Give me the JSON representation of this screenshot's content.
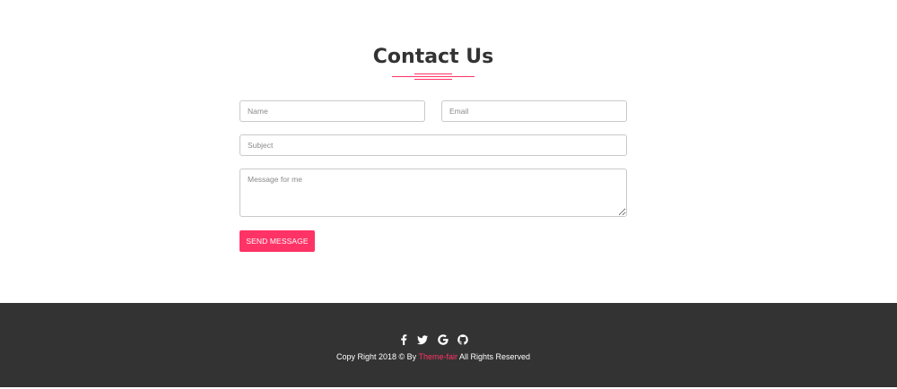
{
  "contact": {
    "title": "Contact Us",
    "accent_color": "#ff3366",
    "fields": {
      "name": {
        "placeholder": "Name",
        "value": ""
      },
      "email": {
        "placeholder": "Email",
        "value": ""
      },
      "subject": {
        "placeholder": "Subject",
        "value": ""
      },
      "message": {
        "placeholder": "Message for me",
        "value": ""
      }
    },
    "send_button_label": "SEND MESSAGE"
  },
  "footer": {
    "background_color": "#333333",
    "social_icons": [
      "facebook-icon",
      "twitter-icon",
      "google-icon",
      "github-icon"
    ],
    "copyright_prefix": "Copy Right 2018 © By",
    "brand": "Theme-fair",
    "copyright_suffix": "All Rights Reserved"
  }
}
